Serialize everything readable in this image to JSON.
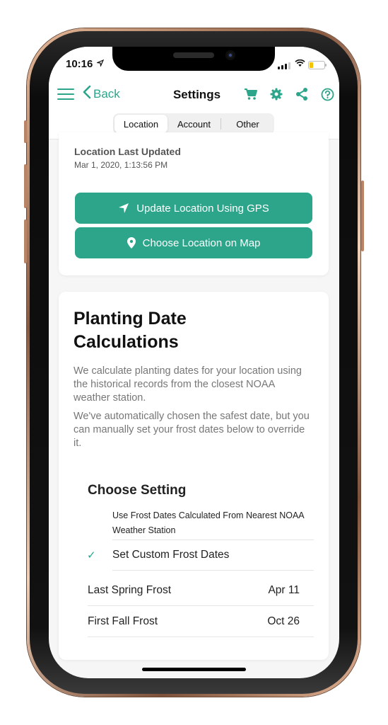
{
  "status_bar": {
    "time": "10:16",
    "location_arrow": "➤",
    "wifi_glyph": "≋"
  },
  "nav": {
    "back_label": "Back",
    "back_chevron": "‹",
    "title": "Settings",
    "icons": [
      "cart-icon",
      "gear-icon",
      "share-icon",
      "help-icon"
    ]
  },
  "tabs": [
    {
      "label": "Location",
      "active": true
    },
    {
      "label": "Account",
      "active": false
    },
    {
      "label": "Other",
      "active": false
    }
  ],
  "location_card": {
    "label": "Location Last Updated",
    "timestamp": "Mar 1, 2020, 1:13:56 PM",
    "gps_button": "Update Location Using GPS",
    "map_button": "Choose Location on Map"
  },
  "planting_card": {
    "title": "Planting Date Calculations",
    "paragraph1": "We calculate planting dates for your location using the historical records from the closest NOAA weather station.",
    "paragraph2": "We've automatically chosen the safest date, but you can manually set your frost dates below to override it.",
    "setting_heading": "Choose Setting",
    "options": [
      {
        "label": "Use Frost Dates Calculated From Nearest NOAA Weather Station",
        "selected": false
      },
      {
        "label": "Set Custom Frost Dates",
        "selected": true
      }
    ],
    "check_glyph": "✓",
    "frost_dates": [
      {
        "label": "Last Spring Frost",
        "value": "Apr 11"
      },
      {
        "label": "First Fall Frost",
        "value": "Oct 26"
      }
    ]
  },
  "colors": {
    "accent": "#2ca58a",
    "battery": "#f5c400"
  }
}
